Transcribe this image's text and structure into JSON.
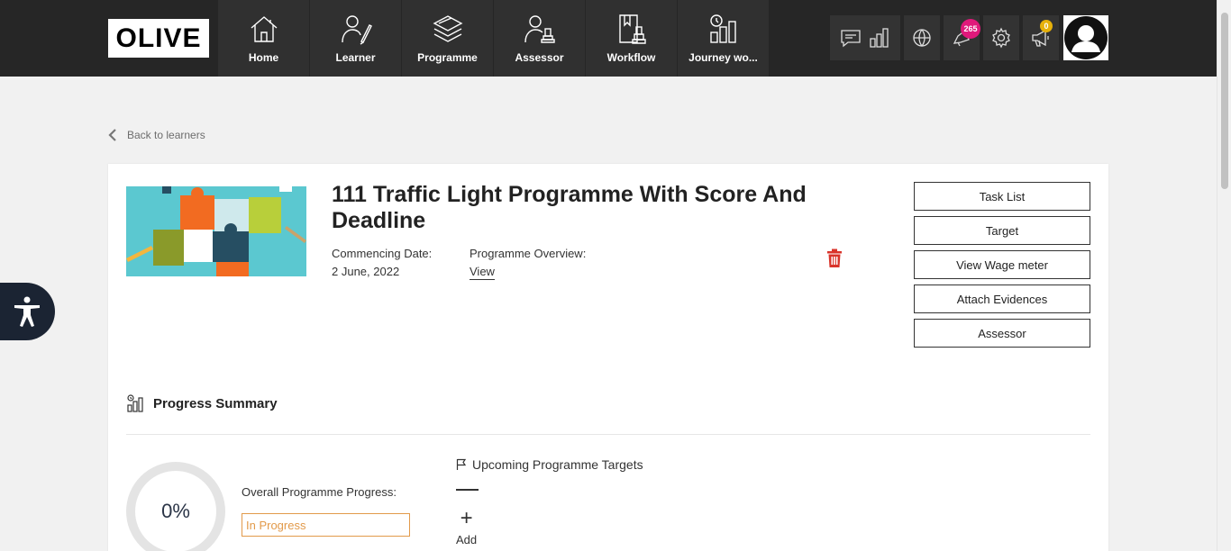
{
  "brand": {
    "logo_text": "OLIVE"
  },
  "nav": [
    {
      "label": "Home",
      "icon": "home-icon"
    },
    {
      "label": "Learner",
      "icon": "learner-icon"
    },
    {
      "label": "Programme",
      "icon": "programme-icon"
    },
    {
      "label": "Assessor",
      "icon": "assessor-icon"
    },
    {
      "label": "Workflow",
      "icon": "workflow-icon"
    },
    {
      "label": "Journey wo...",
      "icon": "journey-icon"
    }
  ],
  "tools": {
    "notifications_count": "265",
    "announcements_count": "0"
  },
  "back_link": "Back to learners",
  "programme": {
    "title": "111 Traffic Light Programme With Score And Deadline",
    "commencing_label": "Commencing Date:",
    "commencing_value": "2 June, 2022",
    "overview_label": "Programme Overview:",
    "overview_link": "View"
  },
  "actions": {
    "task_list": "Task List",
    "target": "Target",
    "wage_meter": "View Wage meter",
    "attach_evidences": "Attach Evidences",
    "assessor": "Assessor"
  },
  "progress": {
    "heading": "Progress Summary",
    "percent": "0%",
    "overall_label": "Overall Programme Progress:",
    "status": "In Progress",
    "upcoming_heading": "Upcoming Programme Targets",
    "add_label": "Add"
  },
  "colors": {
    "topbar": "#262626",
    "nav_tile": "#303030",
    "badge_pink": "#e0197b",
    "badge_gold": "#e7b10a",
    "status_orange": "#e29a4a",
    "trash_red": "#d9342b",
    "a11y_navy": "#1b2433"
  }
}
